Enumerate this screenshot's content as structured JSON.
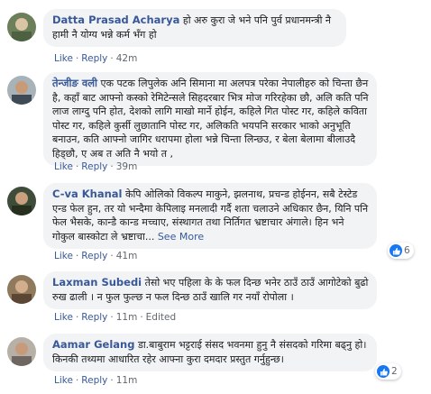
{
  "colors": {
    "link": "#385898",
    "bubble": "#f2f3f5",
    "meta": "#606770",
    "like": "#1877f2"
  },
  "comments": [
    {
      "author": "Datta Prasad Acharya",
      "text": "हो अरु कुरा जे भने पनि पुर्व प्रधानमन्त्री नै हामी नै योग्य भन्ने कर्म भँग हो",
      "like": "Like",
      "reply": "Reply",
      "time": "42m"
    },
    {
      "author": "तेन्जीङ वली",
      "text": "एक पटक लिपुलेक अनि सिमाना मा अलपत्र परेका नेपालीहरु को चिन्ता छैन है, कहाँ बाट आफ्नो कस्को रेमिटेन्सले सिहदरबार भित्र मोज गरिरहेका छौ, अलि कति पनि लाज लाग्दु पनि होत, देशको लागि माखो मार्ने होईन, कहिले गित पोस्ट गर, कहिले कविता पोस्ट गर, कहिले कुर्सी लुछातानि पोस्ट गर, अलिकति भयपनि सरकार भाको अनुभूति बनाउन, कति आफ्नो जागिर धरापमा होला भन्ने चिन्ता लिन्छउ, र बेला बेलामा बीलाउदै हिड्छौ, ए अब त अति नै भयो त ,",
      "like": "Like",
      "reply": "Reply",
      "time": "39m"
    },
    {
      "author": "C-va Khanal",
      "text": "केपि ओलिको विकल्प माकुने, झलनाथ, प्रचन्ड होईनन, सबै टेस्टेड एन्ड फेल हुन, तर यो भन्दैमा केपिलाइ मनलादी गर्दै शता चलाउने अधिकार छैन, यिनि पनि फेल भैसके, कान्डै कान्ड मच्चाए, संस्थागत तथा निर्तिगत भ्रष्टाचार अंगाले। हिन भने गोकुल बास्कोटा ले भ्रष्टाचा...",
      "see_more": "See More",
      "like": "Like",
      "reply": "Reply",
      "time": "41m",
      "reaction_count": "6"
    },
    {
      "author": "Laxman Subedi",
      "text": "तेसो भए पहिला के के फल दिन्छ भनेर ठाउँ ठाउँ आगोटेको बुढो रुख ढाली । न फुल फुल्छ न फल दिन्छ ठाउँ खालि गर नयाँ रोपोला ।",
      "like": "Like",
      "reply": "Reply",
      "time": "11m",
      "edited": "Edited"
    },
    {
      "author": "Aamar Gelang",
      "text": "डा.बाबुराम भट्टराई संसद भवनमा हुनु नै संसदको गरिमा बढ्नु हो।किनकी तथ्यमा आधारित रहेर आफ्ना कुरा दमदार प्रस्तुत गर्नुहुन्छ।",
      "like": "Like",
      "reply": "Reply",
      "time": "11m",
      "reaction_count": "2"
    }
  ]
}
